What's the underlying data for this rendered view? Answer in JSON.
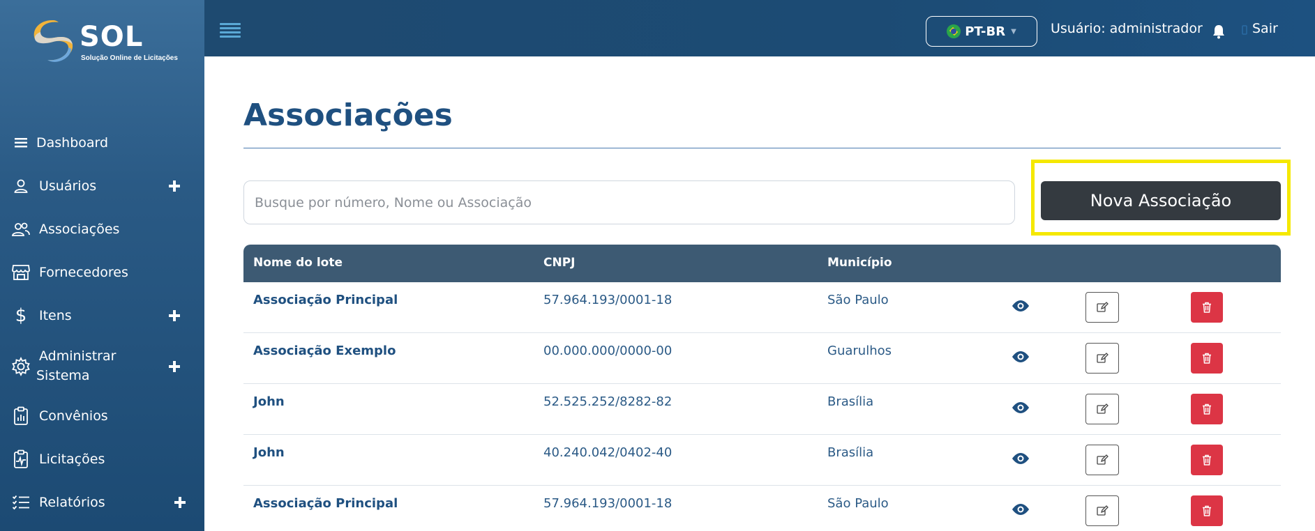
{
  "brand": {
    "name": "SOL",
    "tagline": "Solução Online de Licitações"
  },
  "sidebar": {
    "items": [
      {
        "label": "Dashboard",
        "icon": "bars-icon",
        "expandable": false
      },
      {
        "label": "Usuários",
        "icon": "user-icon",
        "expandable": true
      },
      {
        "label": "Associações",
        "icon": "users-icon",
        "expandable": false
      },
      {
        "label": "Fornecedores",
        "icon": "store-icon",
        "expandable": false
      },
      {
        "label": "Itens",
        "icon": "dollar-icon",
        "expandable": true
      },
      {
        "label": "Administrar",
        "label2": "Sistema",
        "icon": "gear-icon",
        "expandable": true
      },
      {
        "label": "Convênios",
        "icon": "clipboard-chart-icon",
        "expandable": false
      },
      {
        "label": "Licitações",
        "icon": "clipboard-pulse-icon",
        "expandable": false
      },
      {
        "label": "Relatórios",
        "icon": "list-check-icon",
        "expandable": true
      }
    ]
  },
  "topbar": {
    "language": "PT-BR",
    "user_label": "Usuário: administrador",
    "logout": "Sair"
  },
  "page": {
    "title": "Associações",
    "search_placeholder": "Busque por número, Nome ou Associação",
    "new_button": "Nova Associação"
  },
  "table": {
    "headers": {
      "name": "Nome do lote",
      "cnpj": "CNPJ",
      "city": "Município"
    },
    "rows": [
      {
        "name": "Associação Principal",
        "cnpj": "57.964.193/0001-18",
        "city": "São Paulo"
      },
      {
        "name": "Associação Exemplo",
        "cnpj": "00.000.000/0000-00",
        "city": "Guarulhos"
      },
      {
        "name": "John",
        "cnpj": "52.525.252/8282-82",
        "city": "Brasília"
      },
      {
        "name": "John",
        "cnpj": "40.240.042/0402-40",
        "city": "Brasília"
      },
      {
        "name": "Associação Principal",
        "cnpj": "57.964.193/0001-18",
        "city": "São Paulo"
      }
    ]
  },
  "colors": {
    "sidebar": "#2a5a85",
    "topbar": "#1e4a70",
    "primary_text": "#1f5080",
    "table_header": "#3d5a73",
    "dark_button": "#343a40",
    "delete": "#dc3545",
    "highlight": "#f5e800"
  }
}
